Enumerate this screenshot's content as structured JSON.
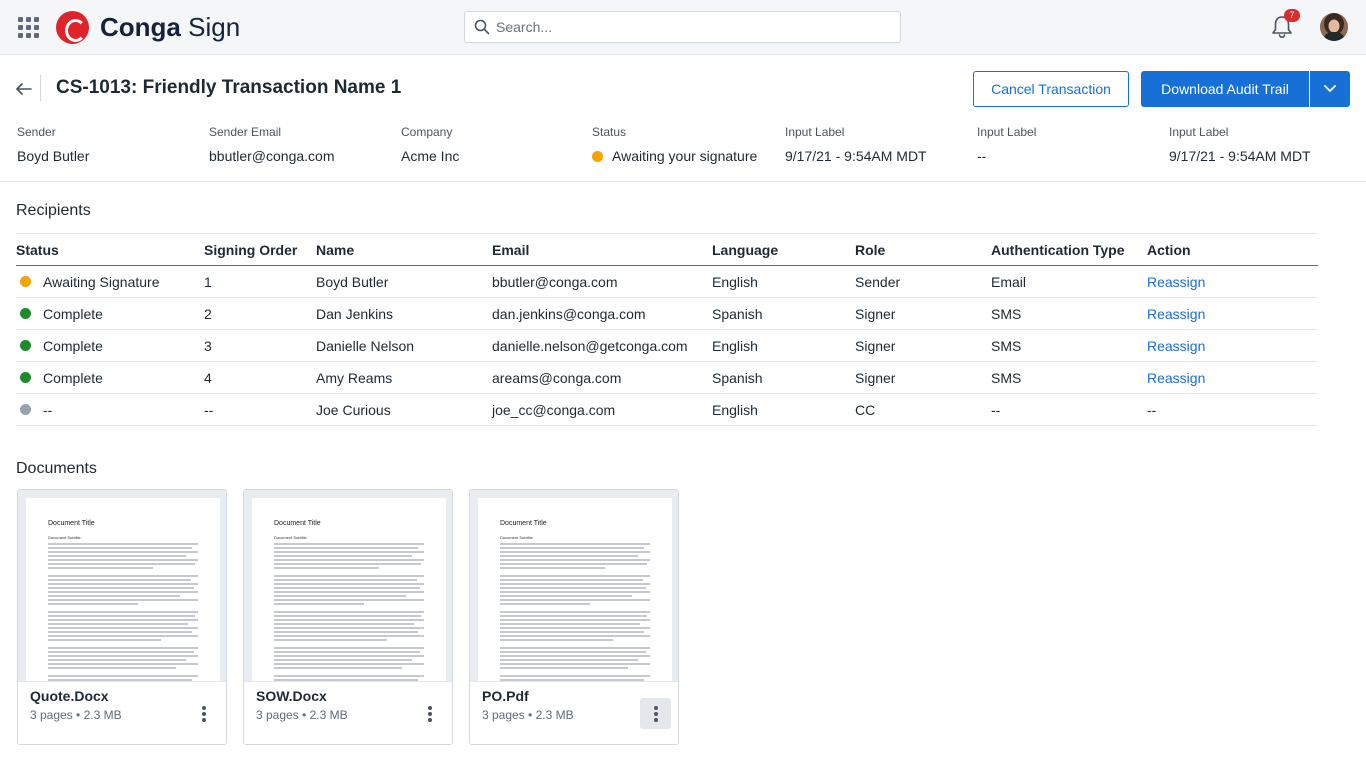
{
  "app": {
    "brand_bold": "Conga",
    "brand_light": "Sign",
    "notification_count": "7"
  },
  "search": {
    "placeholder": "Search..."
  },
  "header": {
    "title": "CS-1013: Friendly Transaction Name 1",
    "cancel_label": "Cancel Transaction",
    "download_label": "Download Audit Trail"
  },
  "meta": [
    {
      "label": "Sender",
      "value": "Boyd Butler"
    },
    {
      "label": "Sender Email",
      "value": "bbutler@conga.com"
    },
    {
      "label": "Company",
      "value": "Acme Inc"
    },
    {
      "label": "Status",
      "value": "Awaiting your signature",
      "color": "#f5a300"
    },
    {
      "label": "Input Label",
      "value": "9/17/21 - 9:54AM MDT"
    },
    {
      "label": "Input Label",
      "value": "--"
    },
    {
      "label": "Input Label",
      "value": "9/17/21 - 9:54AM MDT"
    }
  ],
  "recipients": {
    "title": "Recipients",
    "columns": [
      "Status",
      "Signing Order",
      "Name",
      "Email",
      "Language",
      "Role",
      "Authentication Type",
      "Action"
    ],
    "rows": [
      {
        "status": "Awaiting Signature",
        "color": "#f5a300",
        "order": "1",
        "name": "Boyd Butler",
        "email": "bbutler@conga.com",
        "language": "English",
        "role": "Sender",
        "auth": "Email",
        "action": "Reassign"
      },
      {
        "status": "Complete",
        "color": "#1e8a2e",
        "order": "2",
        "name": "Dan Jenkins",
        "email": "dan.jenkins@conga.com",
        "language": "Spanish",
        "role": "Signer",
        "auth": "SMS",
        "action": "Reassign"
      },
      {
        "status": "Complete",
        "color": "#1e8a2e",
        "order": "3",
        "name": "Danielle Nelson",
        "email": "danielle.nelson@getconga.com",
        "language": "English",
        "role": "Signer",
        "auth": "SMS",
        "action": "Reassign"
      },
      {
        "status": "Complete",
        "color": "#1e8a2e",
        "order": "4",
        "name": "Amy Reams",
        "email": "areams@conga.com",
        "language": "Spanish",
        "role": "Signer",
        "auth": "SMS",
        "action": "Reassign"
      },
      {
        "status": "--",
        "color": "#9aa1ab",
        "order": "--",
        "name": "Joe Curious",
        "email": "joe_cc@conga.com",
        "language": "English",
        "role": "CC",
        "auth": "--",
        "action": "--"
      }
    ]
  },
  "documents": {
    "title": "Documents",
    "preview_title": "Document Title",
    "preview_subtitle": "Document Subtitle",
    "items": [
      {
        "name": "Quote.Docx",
        "info": "3 pages • 2.3 MB"
      },
      {
        "name": "SOW.Docx",
        "info": "3 pages • 2.3 MB"
      },
      {
        "name": "PO.Pdf",
        "info": "3 pages • 2.3 MB"
      }
    ]
  }
}
